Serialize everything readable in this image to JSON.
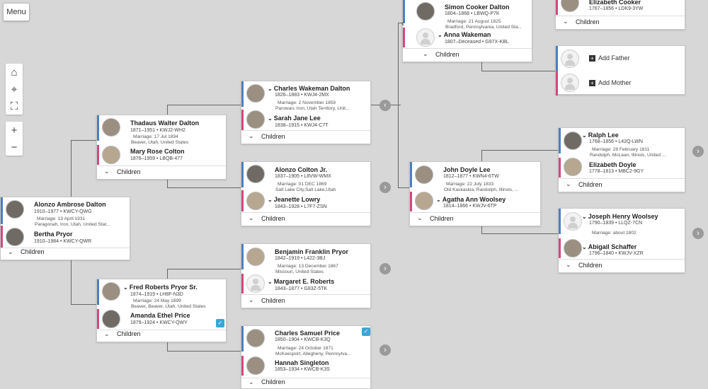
{
  "menu_label": "Menu",
  "controls": {
    "home": "⌂",
    "recenter": "⌖",
    "fullscreen": "⛶",
    "zoom_in": "+",
    "zoom_out": "−"
  },
  "children_label": "Children",
  "add_father": "Add Father",
  "add_mother": "Add Mother",
  "couples": {
    "c1": {
      "h_name": "Alonzo Ambrose Dalton",
      "h_meta": "1910–1977 • KWCY-QWG",
      "marriage": "Marriage: 13 April 1931",
      "place": "Paragonah, Iron, Utah, United Stat...",
      "w_name": "Bertha Pryor",
      "w_meta": "1910–1984 • KWCY-QWR"
    },
    "c2": {
      "h_name": "Thadaus Walter Dalton",
      "h_meta": "1871–1951 • KWJ2-WH2",
      "marriage": "Marriage: 17 Jul 1894",
      "place": "Beaver, Utah, United States",
      "w_name": "Mary Rose Colton",
      "w_meta": "1876–1959 • LBQB-477"
    },
    "c3": {
      "h_name": "Fred Roberts Pryor Sr.",
      "h_meta": "1874–1919 • LH8F-N3D",
      "marriage": "Marriage: 24 May 1899",
      "place": "Beaver, Beaver, Utah, United States",
      "w_name": "Amanda Ethel Price",
      "w_meta": "1879–1924 • KWCY-QWY"
    },
    "c4": {
      "h_name": "Charles Wakeman Dalton",
      "h_meta": "1826–1883 • KWJ4-2MX",
      "marriage": "Marriage: 2 November 1859",
      "place": "Parowan, Iron, Utah Territory, Unit...",
      "w_name": "Sarah Jane Lee",
      "w_meta": "1838–1915 • KWJ4-C7T"
    },
    "c5": {
      "h_name": "Alonzo Colton Jr.",
      "h_meta": "1837–1905 • L8VW-WMX",
      "marriage": "Marriage: 01 DEC 1869",
      "place": "Salt Lake City,Salt Lake,Utah",
      "w_name": "Jeanette Lowry",
      "w_meta": "1843–1928 • L7F7-ZSN"
    },
    "c6": {
      "h_name": "Benjamin Franklin Pryor",
      "h_meta": "1842–1919 • L422-3BJ",
      "marriage": "Marriage: 13 December 1867",
      "place": "Missouri, United States",
      "w_name": "Margaret E. Roberts",
      "w_meta": "1843–1877 • G83Z-5TK"
    },
    "c7": {
      "h_name": "Charles Samuel Price",
      "h_meta": "1850–1904 • KWCB-K3Q",
      "marriage": "Marriage: 24 October 1871",
      "place": "McKeesport, Allegheny, Pennsylva...",
      "w_name": "Hannah Singleton",
      "w_meta": "1853–1934 • KWCB-K3S"
    },
    "c8": {
      "h_name": "Simon Cooker Dalton",
      "h_meta": "1804–1868 • LBWQ-P7K",
      "marriage": "Marriage: 21 August 1825",
      "place": "Bradford, Pennsylvania, United Sta...",
      "w_name": "Anna Wakeman",
      "w_meta": "1807–Deceased • G97X-KBL"
    },
    "c9": {
      "h_name": "John Doyle Lee",
      "h_meta": "1812–1877 • KWN4-6TW",
      "marriage": "Marriage: 22 July 1833",
      "place": "Old Kaskaskia, Randolph, Illinois, ...",
      "w_name": "Agatha Ann Woolsey",
      "w_meta": "1814–1866 • KWJV-6TP"
    },
    "c10": {
      "h_name": "Ralph Lee",
      "h_meta": "1768–1856 • L42Q-LWN",
      "marriage": "Marriage: 28 February 1811",
      "place": "Randolph, McLean, Illinois, United ...",
      "w_name": "Elizabeth Doyle",
      "w_meta": "1778–1813 • MBC2-9GY"
    },
    "c11": {
      "h_name": "Joseph Henry Woolsey",
      "h_meta": "1790–1839 • LLQZ-7CN",
      "marriage": "Marriage: about 1802",
      "place": "",
      "w_name": "Abigail Schaffer",
      "w_meta": "1796–1840 • KWJV-XZR"
    },
    "c12": {
      "w_name": "Elizabeth Cooker",
      "w_meta": "1767–1856 • LDK9-3YW"
    }
  }
}
